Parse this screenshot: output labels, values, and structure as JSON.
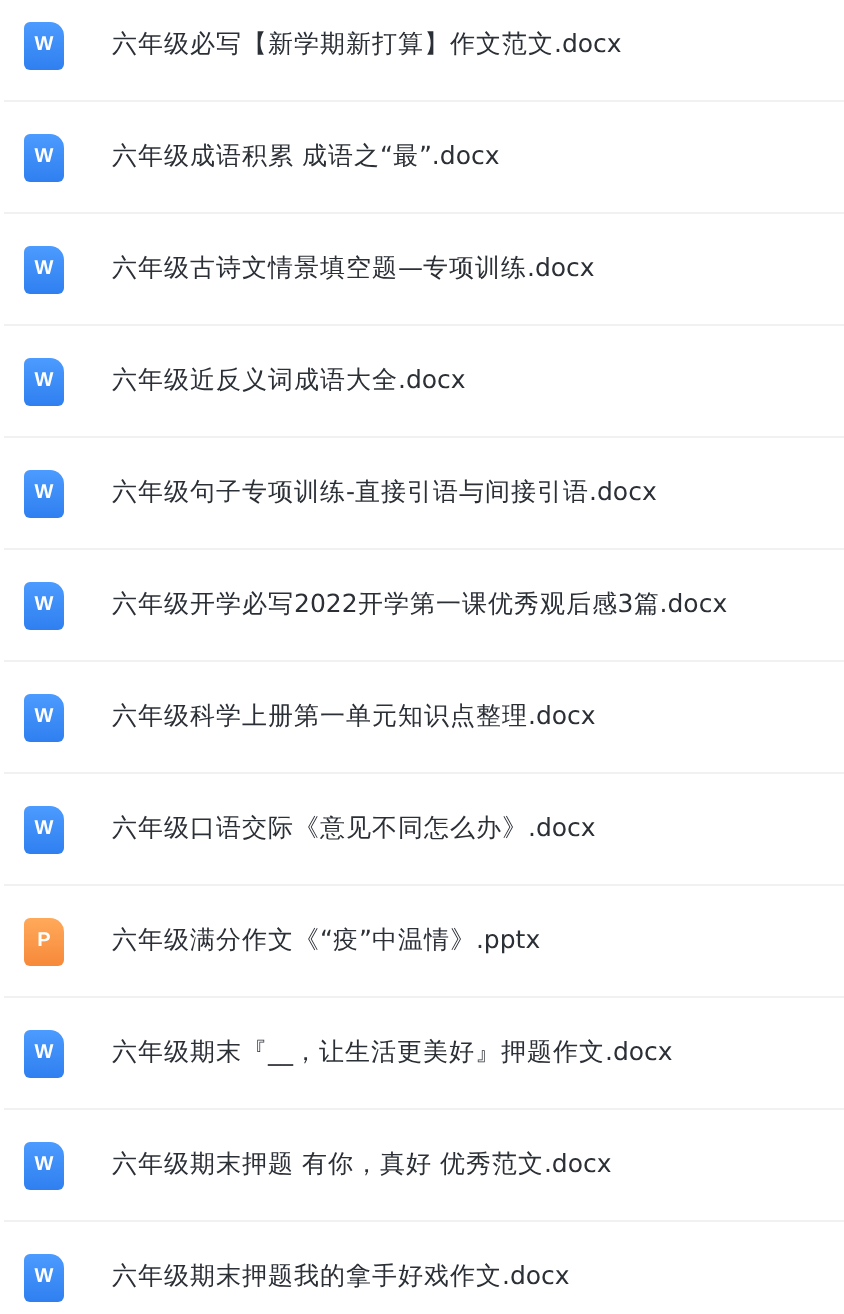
{
  "files": [
    {
      "name": "六年级必写【新学期新打算】作文范文.docx",
      "kind": "docx",
      "icon_letter": "W"
    },
    {
      "name": "六年级成语积累 成语之“最”.docx",
      "kind": "docx",
      "icon_letter": "W"
    },
    {
      "name": "六年级古诗文情景填空题—专项训练.docx",
      "kind": "docx",
      "icon_letter": "W"
    },
    {
      "name": "六年级近反义词成语大全.docx",
      "kind": "docx",
      "icon_letter": "W"
    },
    {
      "name": "六年级句子专项训练-直接引语与间接引语.docx",
      "kind": "docx",
      "icon_letter": "W"
    },
    {
      "name": "六年级开学必写2022开学第一课优秀观后感3篇.docx",
      "kind": "docx",
      "icon_letter": "W"
    },
    {
      "name": "六年级科学上册第一单元知识点整理.docx",
      "kind": "docx",
      "icon_letter": "W"
    },
    {
      "name": "六年级口语交际《意见不同怎么办》.docx",
      "kind": "docx",
      "icon_letter": "W"
    },
    {
      "name": "六年级满分作文《“疫”中温情》.pptx",
      "kind": "pptx",
      "icon_letter": "P"
    },
    {
      "name": "六年级期末『__，让生活更美好』押题作文.docx",
      "kind": "docx",
      "icon_letter": "W"
    },
    {
      "name": "六年级期末押题 有你，真好 优秀范文.docx",
      "kind": "docx",
      "icon_letter": "W"
    },
    {
      "name": "六年级期末押题我的拿手好戏作文.docx",
      "kind": "docx",
      "icon_letter": "W"
    }
  ]
}
